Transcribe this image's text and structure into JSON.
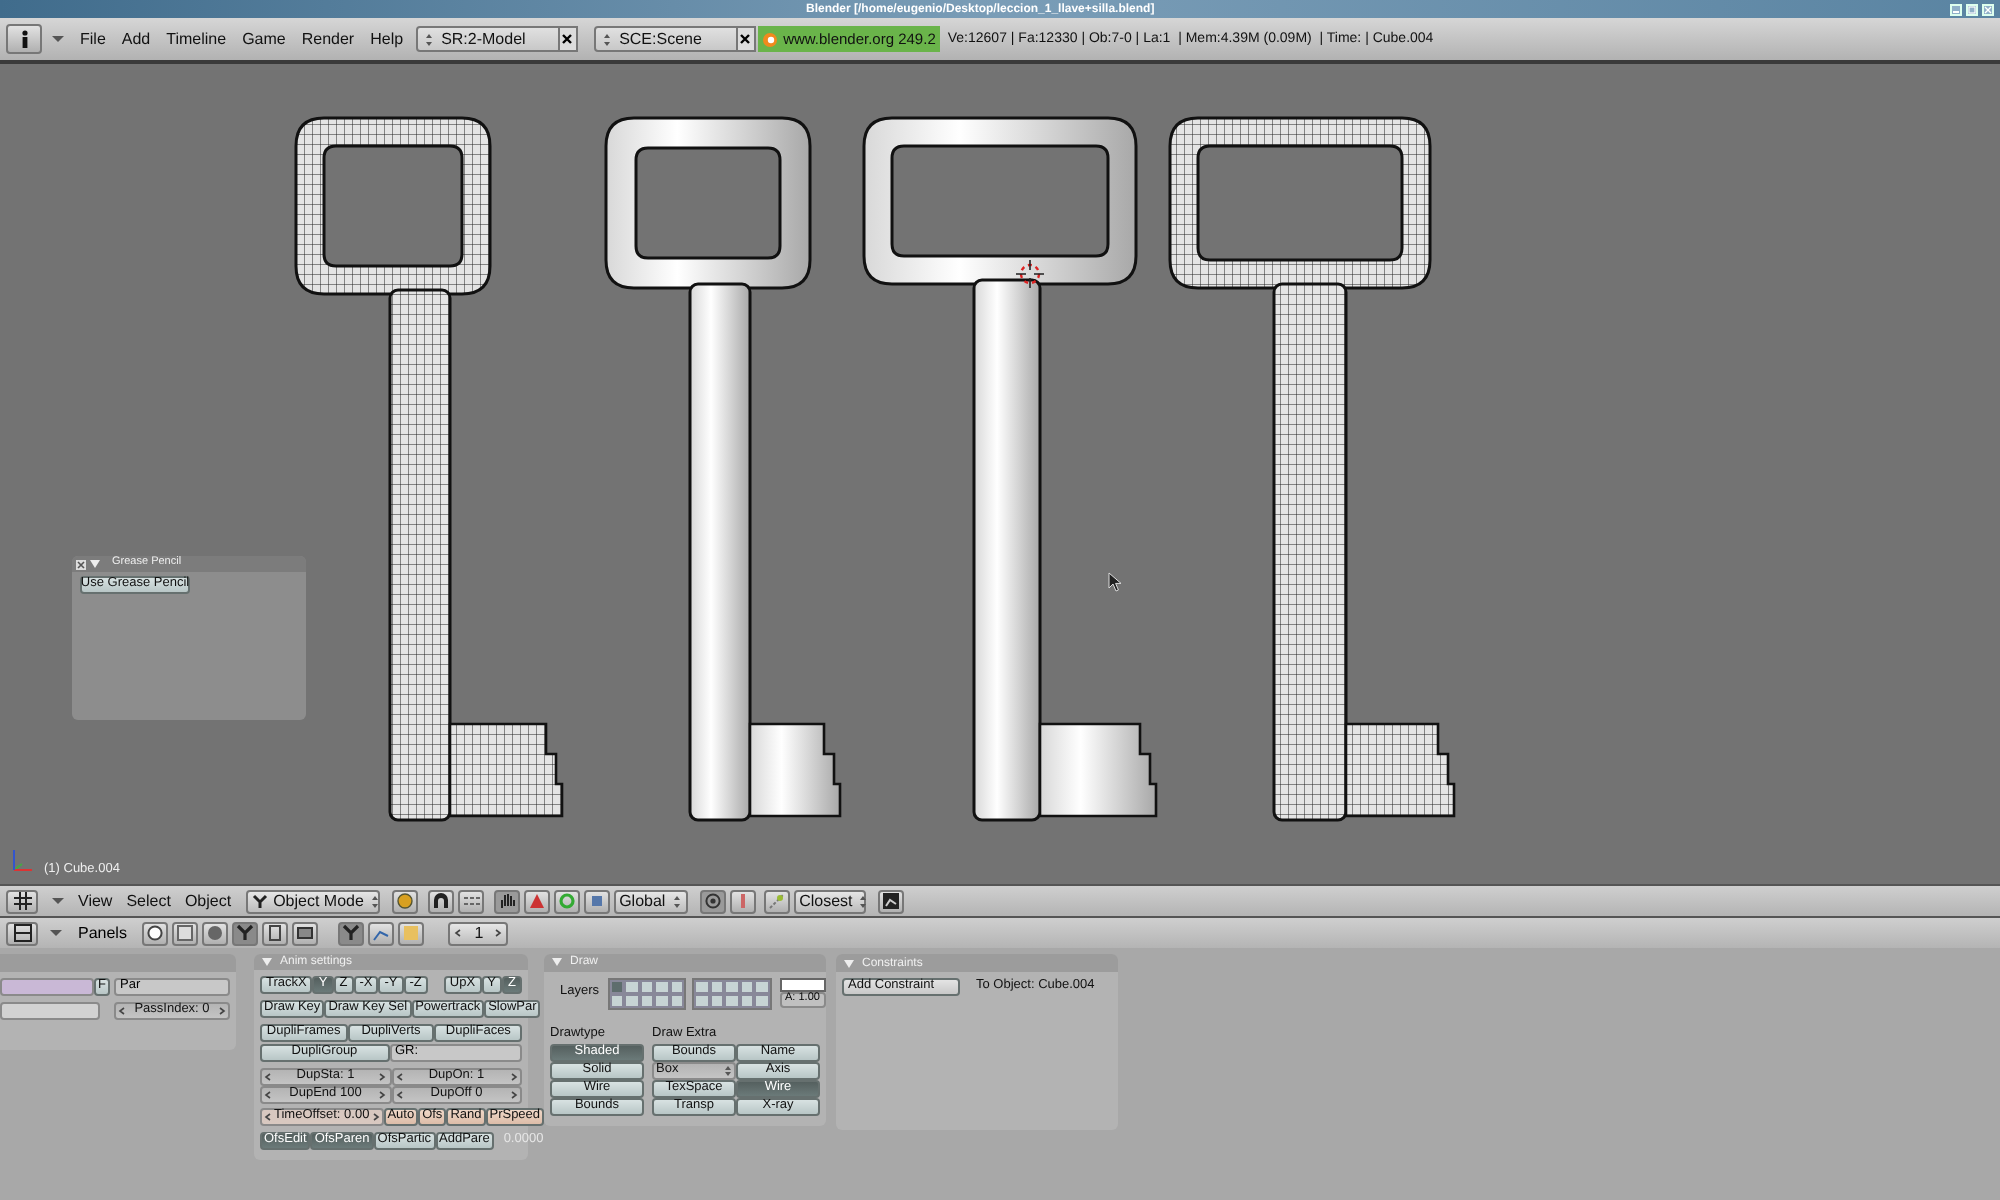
{
  "window": {
    "title": "Blender [/home/eugenio/Desktop/leccion_1_llave+silla.blend]"
  },
  "info_header": {
    "menus": [
      "File",
      "Add",
      "Timeline",
      "Game",
      "Render",
      "Help"
    ],
    "screen": "SR:2-Model",
    "scene": "SCE:Scene",
    "version": "www.blender.org 249.2",
    "stats": "Ve:12607 | Fa:12330 | Ob:7-0 | La:1  | Mem:4.39M (0.09M)  | Time: | Cube.004"
  },
  "viewport": {
    "grease_pencil": {
      "title": "Grease Pencil",
      "button": "Use Grease Pencil"
    },
    "object_label": "(1) Cube.004"
  },
  "viewport_header": {
    "menus": [
      "View",
      "Select",
      "Object"
    ],
    "mode": "Object Mode",
    "orientation": "Global",
    "snap": "Closest"
  },
  "buttons_header": {
    "label": "Panels",
    "frame": "1"
  },
  "object_panel": {
    "flag": "F",
    "parent": "Par",
    "pass_index": "PassIndex: 0"
  },
  "anim_settings": {
    "title": "Anim settings",
    "track": [
      {
        "label": "TrackX",
        "selected": false
      },
      {
        "label": "Y",
        "selected": true
      },
      {
        "label": "Z",
        "selected": false
      },
      {
        "label": "-X",
        "selected": false
      },
      {
        "label": "-Y",
        "selected": false
      },
      {
        "label": "-Z",
        "selected": false
      }
    ],
    "up": [
      {
        "label": "UpX",
        "selected": false
      },
      {
        "label": "Y",
        "selected": false
      },
      {
        "label": "Z",
        "selected": true
      }
    ],
    "draw_keys": [
      "Draw Key",
      "Draw Key Sel",
      "Powertrack",
      "SlowPar"
    ],
    "dupli": [
      "DupliFrames",
      "DupliVerts",
      "DupliFaces",
      "DupliGroup"
    ],
    "group": "GR:",
    "numbers": [
      "DupSta: 1",
      "DupOn: 1",
      "DupEnd 100",
      "DupOff 0"
    ],
    "time_offset": "TimeOffset: 0.00",
    "offset_buttons": [
      "Auto",
      "Ofs",
      "Rand",
      "PrSpeed"
    ],
    "ofs_toggles": [
      {
        "label": "OfsEdit",
        "selected": true
      },
      {
        "label": "OfsParen",
        "selected": true
      },
      {
        "label": "OfsPartic",
        "selected": false
      },
      {
        "label": "AddPare",
        "selected": false
      }
    ],
    "speed": "0.0000"
  },
  "draw": {
    "title": "Draw",
    "layers_label": "Layers",
    "layers": [
      {
        "on": true
      },
      {
        "on": false
      },
      {
        "on": false
      },
      {
        "on": false
      },
      {
        "on": false
      },
      {
        "on": false
      },
      {
        "on": false
      },
      {
        "on": false
      },
      {
        "on": false
      },
      {
        "on": false
      },
      {
        "on": false
      },
      {
        "on": false
      },
      {
        "on": false
      },
      {
        "on": false
      },
      {
        "on": false
      },
      {
        "on": false
      },
      {
        "on": false
      },
      {
        "on": false
      },
      {
        "on": false
      },
      {
        "on": false
      }
    ],
    "alpha": "A: 1.00",
    "drawtype_label": "Drawtype",
    "drawtypes": [
      {
        "label": "Shaded",
        "selected": true
      },
      {
        "label": "Solid",
        "selected": false
      },
      {
        "label": "Wire",
        "selected": false
      },
      {
        "label": "Bounds",
        "selected": false
      }
    ],
    "extra_label": "Draw Extra",
    "extras": [
      {
        "kind": "toggle",
        "label": "Bounds",
        "on": false
      },
      {
        "kind": "toggle",
        "label": "Name",
        "on": false
      },
      {
        "kind": "dropdown",
        "label": "Box"
      },
      {
        "kind": "toggle",
        "label": "Axis",
        "on": false
      },
      {
        "kind": "toggle",
        "label": "TexSpace",
        "on": false
      },
      {
        "kind": "toggle",
        "label": "Wire",
        "on": true
      },
      {
        "kind": "toggle",
        "label": "Transp",
        "on": false
      },
      {
        "kind": "toggle",
        "label": "X-ray",
        "on": false
      }
    ]
  },
  "constraints": {
    "title": "Constraints",
    "button": "Add Constraint",
    "target": "To Object: Cube.004"
  }
}
